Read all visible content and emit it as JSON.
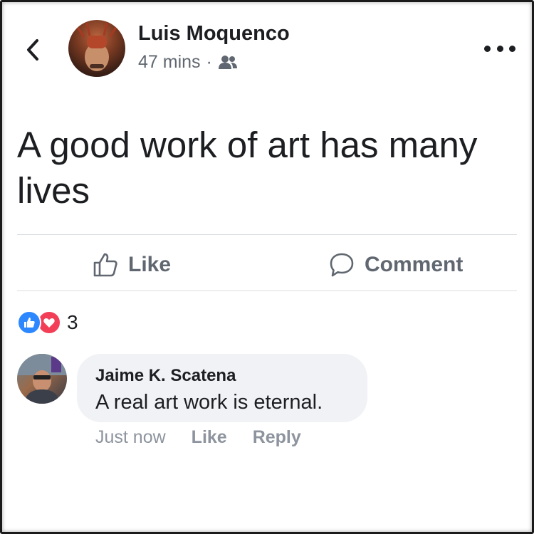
{
  "header": {
    "author": "Luis Moquenco",
    "time": "47 mins",
    "separator": "·",
    "audience_icon": "friends-icon",
    "back_icon": "chevron-left-icon",
    "more_icon": "more-horizontal-icon"
  },
  "post": {
    "text": "A good work of art has many lives"
  },
  "actions": {
    "like_label": "Like",
    "comment_label": "Comment",
    "like_icon": "thumbs-up-icon",
    "comment_icon": "speech-bubble-icon"
  },
  "reactions": {
    "types": [
      "like",
      "love"
    ],
    "count": "3",
    "colors": {
      "like": "#2d88ff",
      "love": "#f33e58"
    }
  },
  "comment": {
    "author": "Jaime K. Scatena",
    "text": "A real art work is eternal.",
    "time": "Just now",
    "like_label": "Like",
    "reply_label": "Reply"
  }
}
